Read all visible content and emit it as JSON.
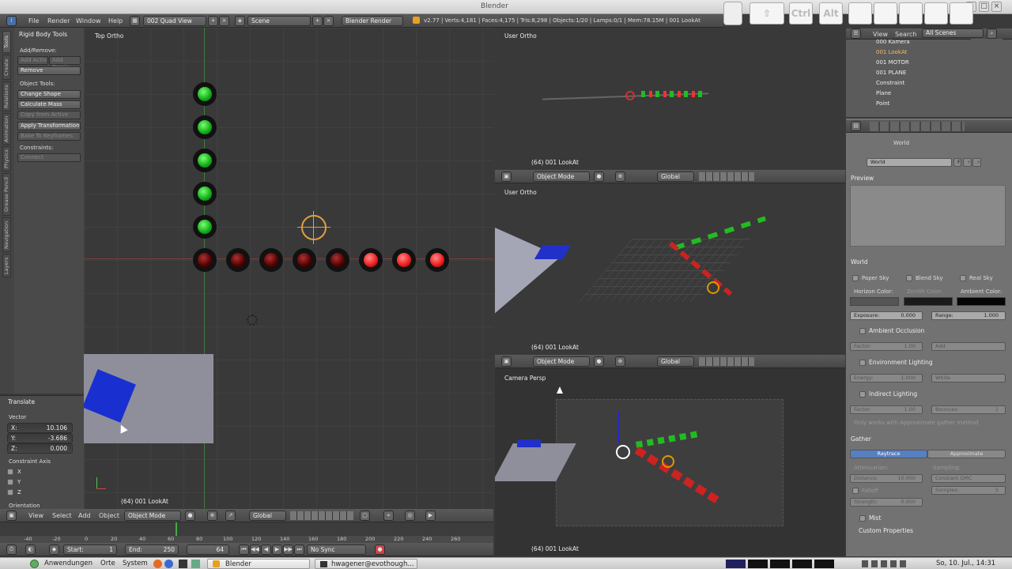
{
  "window": {
    "title": "Blender"
  },
  "osk": {
    "ctrl": "Ctrl",
    "alt": "Alt"
  },
  "info_header": {
    "menus": [
      "File",
      "Render",
      "Window",
      "Help"
    ],
    "screen_layout": "002 Quad View",
    "scene": "Scene",
    "render_engine": "Blender Render",
    "stats": "v2.77 | Verts:4,181 | Faces:4,175 | Tris:8,298 | Objects:1/20 | Lamps:0/1 | Mem:78.15M | 001 LookAt"
  },
  "toolshelf": {
    "panel_title": "Rigid Body Tools",
    "add_remove_label": "Add/Remove:",
    "add_active": "Add Activ",
    "add_passive": "Add Passiv",
    "remove": "Remove",
    "object_tools_label": "Object Tools:",
    "change_shape": "Change Shape",
    "calculate_mass": "Calculate Mass",
    "copy_from_active": "Copy from Active",
    "apply_transformation": "Apply Transformation",
    "bake_to_keyframes": "Bake To Keyframes",
    "constraints_label": "Constraints:",
    "connect": "Connect",
    "tabs": [
      "Tools",
      "Create",
      "Relations",
      "Animation",
      "Physics",
      "Grease Pencil",
      "Navigation",
      "Layers"
    ]
  },
  "operator_panel": {
    "title": "Translate",
    "vector_label": "Vector",
    "x": "X:",
    "x_value": "10.106",
    "y": "Y:",
    "y_value": "-3.686",
    "z": "Z:",
    "z_value": "0.000",
    "constraint_axis": "Constraint Axis",
    "axis_x": "X",
    "axis_y": "Y",
    "axis_z": "Z",
    "orientation": "Orientation"
  },
  "viewports": {
    "top_left": {
      "label": "Top Ortho",
      "info": "(64) 001 LookAt"
    },
    "top_right": {
      "label": "User Ortho",
      "info": "(64) 001 LookAt"
    },
    "mid_right": {
      "label": "User Ortho",
      "info": "(64) 001 LookAt"
    },
    "bottom_right": {
      "label": "Camera Persp",
      "info": "(64) 001 LookAt"
    }
  },
  "view3d_header": {
    "view": "View",
    "select": "Select",
    "add": "Add",
    "object": "Object",
    "mode": "Object Mode",
    "orientation": "Global"
  },
  "timeline": {
    "ticks": [
      "-40",
      "-20",
      "0",
      "20",
      "40",
      "60",
      "80",
      "100",
      "120",
      "140",
      "160",
      "180",
      "200",
      "220",
      "240",
      "260"
    ],
    "start_label": "Start:",
    "start": "1",
    "end_label": "End:",
    "end": "250",
    "current": "64",
    "sync": "No Sync"
  },
  "outliner": {
    "view": "View",
    "search": "Search",
    "filter": "All Scenes",
    "items": [
      "000 Kamera",
      "001 LookAt",
      "001 MOTOR",
      "001 PLANE",
      "Constraint",
      "Plane",
      "Point"
    ]
  },
  "properties": {
    "breadcrumb": "World",
    "world_name": "World",
    "world_users": "F",
    "preview": "Preview",
    "world_panel": "World",
    "paper_sky": "Paper Sky",
    "blend_sky": "Blend Sky",
    "real_sky": "Real Sky",
    "horizon_color": "Horizon Color:",
    "zenith_color": "Zenith Color:",
    "ambient_color": "Ambient Color:",
    "exposure_label": "Exposure:",
    "exposure": "0.000",
    "range_label": "Range:",
    "range": "1.000",
    "ambient_occlusion": "Ambient Occlusion",
    "factor_label": "Factor:",
    "factor": "1.00",
    "ao_blend": "Add",
    "environment_lighting": "Environment Lighting",
    "energy_label": "Energy:",
    "energy": "1.000",
    "env_color": "White",
    "indirect_lighting": "Indirect Lighting",
    "il_factor": "1.00",
    "bounces_label": "Bounces:",
    "bounces": "1",
    "approx_note": "Only works with Approximate gather method",
    "gather": "Gather",
    "raytrace": "Raytrace",
    "approximate": "Approximate",
    "attenuation": "Attenuation:",
    "sampling": "Sampling:",
    "distance_label": "Distance:",
    "distance": "10.000",
    "sampling_method": "Constant QMC",
    "falloff": "Falloff",
    "samples_label": "Samples:",
    "samples": "5",
    "strength_label": "Strength:",
    "strength": "0.000",
    "mist": "Mist",
    "custom_properties": "Custom Properties"
  },
  "taskbar": {
    "applications": "Anwendungen",
    "places": "Orte",
    "system": "System",
    "task_blender": "Blender",
    "task_terminal": "hwagener@evothough...",
    "clock": "So, 10. Jul., 14:31"
  },
  "colors": {
    "header": "#4f4f4f",
    "viewport": "#393939",
    "properties": "#727272",
    "selected_blue": "#5680c2",
    "green_light": "#22bb22",
    "red_light": "#ee2222"
  }
}
